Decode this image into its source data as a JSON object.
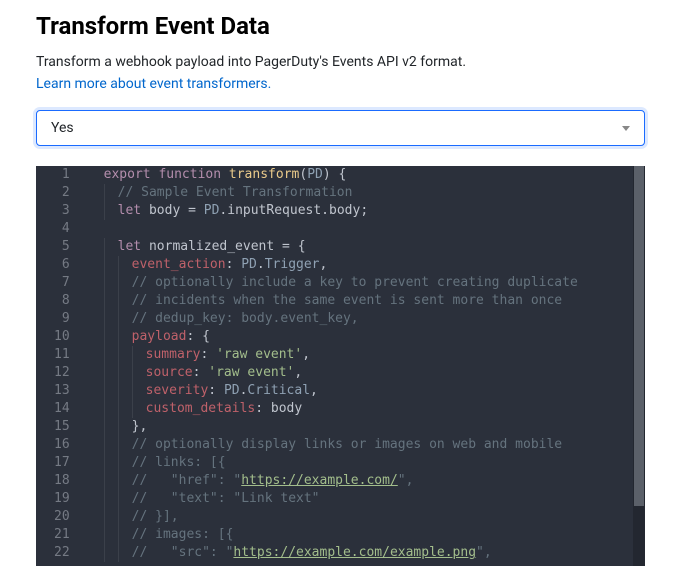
{
  "header": {
    "title": "Transform Event Data",
    "description": "Transform a webhook payload into PagerDuty's Events API v2 format.",
    "link_label": "Learn more about event transformers."
  },
  "select": {
    "value": "Yes"
  },
  "editor": {
    "lines": [
      {
        "n": 1,
        "indent": 0,
        "tokens": [
          [
            "kw",
            "export"
          ],
          [
            "plain",
            " "
          ],
          [
            "kw",
            "function"
          ],
          [
            "plain",
            " "
          ],
          [
            "fn",
            "transform"
          ],
          [
            "punc",
            "("
          ],
          [
            "type",
            "PD"
          ],
          [
            "punc",
            ")"
          ],
          [
            "plain",
            " "
          ],
          [
            "punc",
            "{"
          ]
        ]
      },
      {
        "n": 2,
        "indent": 1,
        "tokens": [
          [
            "comment",
            "// Sample Event Transformation"
          ]
        ]
      },
      {
        "n": 3,
        "indent": 1,
        "tokens": [
          [
            "kw",
            "let"
          ],
          [
            "plain",
            " "
          ],
          [
            "ident",
            "body"
          ],
          [
            "plain",
            " "
          ],
          [
            "punc",
            "="
          ],
          [
            "plain",
            " "
          ],
          [
            "type",
            "PD"
          ],
          [
            "punc",
            "."
          ],
          [
            "ident",
            "inputRequest"
          ],
          [
            "punc",
            "."
          ],
          [
            "ident",
            "body"
          ],
          [
            "punc",
            ";"
          ]
        ]
      },
      {
        "n": 4,
        "indent": 0,
        "tokens": []
      },
      {
        "n": 5,
        "indent": 1,
        "tokens": [
          [
            "kw",
            "let"
          ],
          [
            "plain",
            " "
          ],
          [
            "ident",
            "normalized_event"
          ],
          [
            "plain",
            " "
          ],
          [
            "punc",
            "="
          ],
          [
            "plain",
            " "
          ],
          [
            "punc",
            "{"
          ]
        ]
      },
      {
        "n": 6,
        "indent": 2,
        "tokens": [
          [
            "prop",
            "event_action"
          ],
          [
            "punc",
            ":"
          ],
          [
            "plain",
            " "
          ],
          [
            "type",
            "PD"
          ],
          [
            "punc",
            "."
          ],
          [
            "method",
            "Trigger"
          ],
          [
            "punc",
            ","
          ]
        ]
      },
      {
        "n": 7,
        "indent": 2,
        "tokens": [
          [
            "comment",
            "// optionally include a key to prevent creating duplicate"
          ]
        ]
      },
      {
        "n": 8,
        "indent": 2,
        "tokens": [
          [
            "comment",
            "// incidents when the same event is sent more than once"
          ]
        ]
      },
      {
        "n": 9,
        "indent": 2,
        "tokens": [
          [
            "comment",
            "// dedup_key: body.event_key,"
          ]
        ]
      },
      {
        "n": 10,
        "indent": 2,
        "tokens": [
          [
            "prop",
            "payload"
          ],
          [
            "punc",
            ":"
          ],
          [
            "plain",
            " "
          ],
          [
            "punc",
            "{"
          ]
        ]
      },
      {
        "n": 11,
        "indent": 3,
        "tokens": [
          [
            "prop",
            "summary"
          ],
          [
            "punc",
            ":"
          ],
          [
            "plain",
            " "
          ],
          [
            "str",
            "'raw event'"
          ],
          [
            "punc",
            ","
          ]
        ]
      },
      {
        "n": 12,
        "indent": 3,
        "tokens": [
          [
            "prop",
            "source"
          ],
          [
            "punc",
            ":"
          ],
          [
            "plain",
            " "
          ],
          [
            "str",
            "'raw event'"
          ],
          [
            "punc",
            ","
          ]
        ]
      },
      {
        "n": 13,
        "indent": 3,
        "tokens": [
          [
            "prop",
            "severity"
          ],
          [
            "punc",
            ":"
          ],
          [
            "plain",
            " "
          ],
          [
            "type",
            "PD"
          ],
          [
            "punc",
            "."
          ],
          [
            "method",
            "Critical"
          ],
          [
            "punc",
            ","
          ]
        ]
      },
      {
        "n": 14,
        "indent": 3,
        "tokens": [
          [
            "prop",
            "custom_details"
          ],
          [
            "punc",
            ":"
          ],
          [
            "plain",
            " "
          ],
          [
            "ident",
            "body"
          ]
        ]
      },
      {
        "n": 15,
        "indent": 2,
        "tokens": [
          [
            "punc",
            "},"
          ]
        ]
      },
      {
        "n": 16,
        "indent": 2,
        "tokens": [
          [
            "comment",
            "// optionally display links or images on web and mobile"
          ]
        ]
      },
      {
        "n": 17,
        "indent": 2,
        "tokens": [
          [
            "comment",
            "// links: [{"
          ]
        ]
      },
      {
        "n": 18,
        "indent": 2,
        "tokens": [
          [
            "comment",
            "//   \"href\": \""
          ],
          [
            "str-link",
            "https://example.com/"
          ],
          [
            "comment",
            "\","
          ]
        ]
      },
      {
        "n": 19,
        "indent": 2,
        "tokens": [
          [
            "comment",
            "//   \"text\": \"Link text\""
          ]
        ]
      },
      {
        "n": 20,
        "indent": 2,
        "tokens": [
          [
            "comment",
            "// }],"
          ]
        ]
      },
      {
        "n": 21,
        "indent": 2,
        "tokens": [
          [
            "comment",
            "// images: [{"
          ]
        ]
      },
      {
        "n": 22,
        "indent": 2,
        "tokens": [
          [
            "comment",
            "//   \"src\": \""
          ],
          [
            "str-link",
            "https://example.com/example.png"
          ],
          [
            "comment",
            "\","
          ]
        ]
      }
    ]
  }
}
